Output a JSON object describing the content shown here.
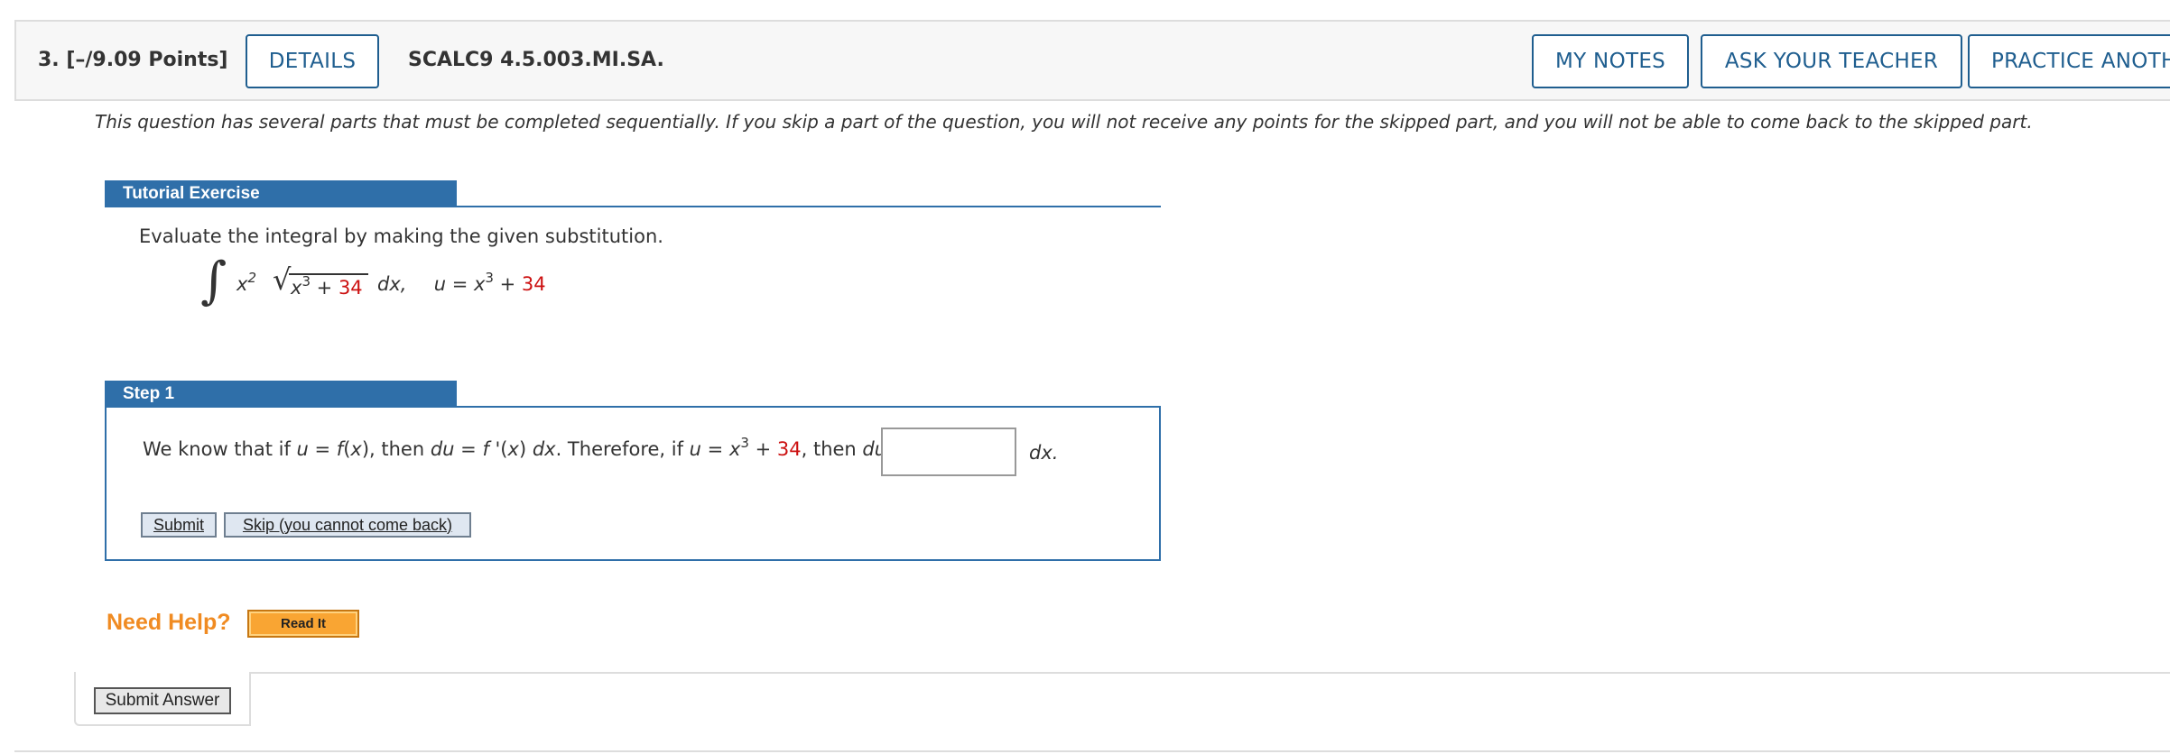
{
  "header": {
    "question_number": "3.",
    "points": "[–/9.09 Points]",
    "details_label": "DETAILS",
    "question_code": "SCALC9 4.5.003.MI.SA.",
    "my_notes_label": "MY NOTES",
    "ask_teacher_label": "ASK YOUR TEACHER",
    "practice_label": "PRACTICE ANOTH"
  },
  "intro": "This question has several parts that must be completed sequentially. If you skip a part of the question, you will not receive any points for the skipped part, and you will not be able to come back to the skipped part.",
  "tutorial": {
    "title": "Tutorial Exercise",
    "instruction": "Evaluate the integral by making the given substitution.",
    "integral": {
      "integrand_base": "x",
      "integrand_exp": "2",
      "radicand_var": "x",
      "radicand_exp": "3",
      "radicand_op": " + ",
      "constant": "34",
      "differential": "dx,",
      "sub_lhs": "u = x",
      "sub_exp": "3",
      "sub_op": " + ",
      "sub_constant": "34"
    }
  },
  "step1": {
    "title": "Step 1",
    "text_part1": "We know that if ",
    "text_u1": "u",
    "text_part2": " = ",
    "text_fx": "f",
    "text_part3": "(",
    "text_x1": "x",
    "text_part4": "), then ",
    "text_du1": "du",
    "text_part5": " = ",
    "text_fprime": "f",
    "text_part6": " '(",
    "text_x2": "x",
    "text_part7": ") ",
    "text_dx1": "dx",
    "text_part8": ". Therefore, if ",
    "text_u2": "u",
    "text_part9": " = ",
    "text_x3": "x",
    "text_exp": "3",
    "text_part10": " + ",
    "text_const": "34",
    "text_part11": ", then ",
    "text_du2": "du",
    "text_part12": " =",
    "answer_value": "",
    "after_input": "dx.",
    "submit_label": "Submit",
    "skip_label": "Skip (you cannot come back)"
  },
  "help": {
    "label": "Need Help?",
    "read_it_label": "Read It"
  },
  "footer": {
    "submit_answer_label": "Submit Answer"
  },
  "colors": {
    "accent_blue": "#2f6fa9",
    "button_blue": "#1f5e8f",
    "red_constant": "#cc1111",
    "help_orange": "#f08b22"
  }
}
